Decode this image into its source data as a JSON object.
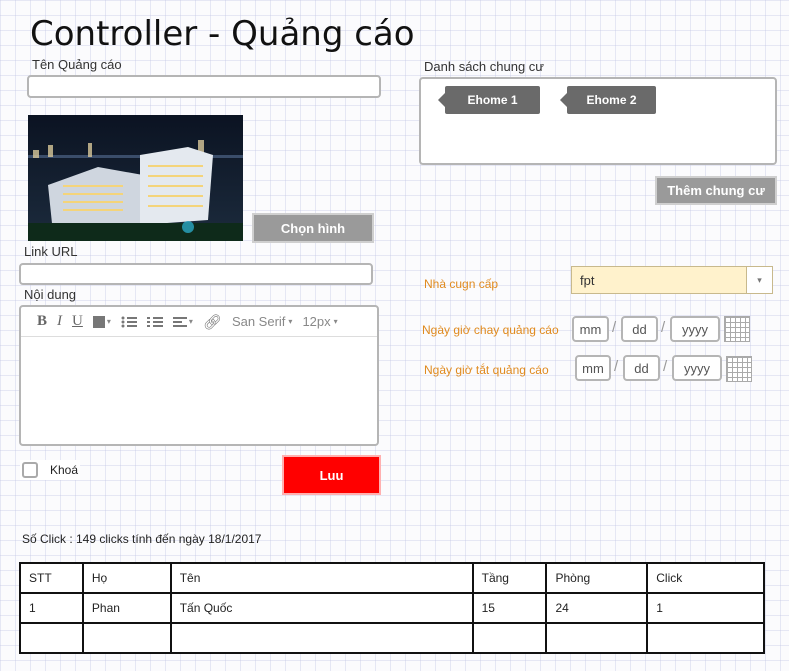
{
  "page": {
    "title": "Controller - Quảng cáo"
  },
  "form": {
    "ad_name_label": "Tên Quảng cáo",
    "ad_name_value": "",
    "choose_image_label": "Chọn hình",
    "link_label": "Link URL",
    "link_value": "",
    "content_label": "Nội dung",
    "lock_label": "Khoá",
    "save_label": "Luu"
  },
  "editor": {
    "bold": "B",
    "italic": "I",
    "underline": "U",
    "font": "San Serif",
    "size": "12px"
  },
  "apartments": {
    "label": "Danh sách chung cư",
    "tags": [
      "Ehome 1",
      "Ehome 2"
    ],
    "add_label": "Thêm chung cư"
  },
  "provider": {
    "label": "Nhà cugn cấp",
    "value": "fpt"
  },
  "start_date": {
    "label": "Ngày giờ chay quảng cáo",
    "mm": "mm",
    "dd": "dd",
    "yyyy": "yyyy"
  },
  "end_date": {
    "label": "Ngày giờ tắt quảng cáo",
    "mm": "mm",
    "dd": "dd",
    "yyyy": "yyyy"
  },
  "stats": {
    "clicks_text": "Số Click : 149 clicks tính đến ngày 18/1/2017"
  },
  "table": {
    "headers": [
      "STT",
      "Họ",
      "Tên",
      "Tầng",
      "Phòng",
      "Click"
    ],
    "rows": [
      [
        "1",
        "Phan",
        "Tấn Quốc",
        "15",
        "24",
        "1"
      ],
      [
        "",
        "",
        "",
        "",
        "",
        ""
      ]
    ]
  },
  "colors": {
    "accent": "#ff0000",
    "orange_label": "#e08a1e",
    "tag": "#6a6a6a"
  }
}
